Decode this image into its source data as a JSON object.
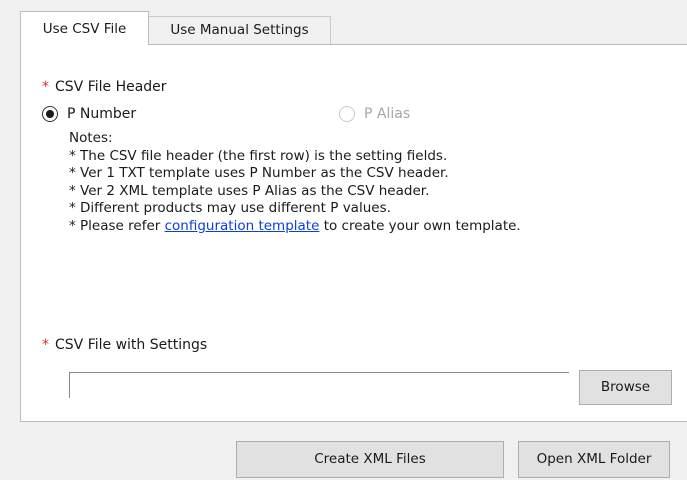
{
  "tabs": [
    {
      "label": "Use CSV File",
      "active": true
    },
    {
      "label": "Use Manual Settings",
      "active": false
    }
  ],
  "csv_header": {
    "required_mark": "*",
    "label": "CSV File Header",
    "options": [
      {
        "label": "P Number",
        "selected": true,
        "enabled": true
      },
      {
        "label": "P Alias",
        "selected": false,
        "enabled": false
      }
    ]
  },
  "notes": {
    "title": "Notes:",
    "line1": "* The CSV file header (the first row) is the setting fields.",
    "line2": "* Ver 1 TXT template uses P Number as the CSV header.",
    "line3": "* Ver 2 XML template uses P Alias as the CSV header.",
    "line4": "* Different products may use different P values.",
    "line5_prefix": "* Please refer ",
    "line5_link": "configuration template",
    "line5_suffix": " to create your own template."
  },
  "csv_settings": {
    "required_mark": "*",
    "label": "CSV File with Settings",
    "file_value": "",
    "browse_label": "Browse"
  },
  "actions": {
    "create_label": "Create XML Files",
    "open_label": "Open XML Folder"
  },
  "colors": {
    "required": "#e0302a",
    "link": "#0a3ee0",
    "button_bg": "#e1e1e1",
    "disabled_text": "#a6a6a6"
  }
}
